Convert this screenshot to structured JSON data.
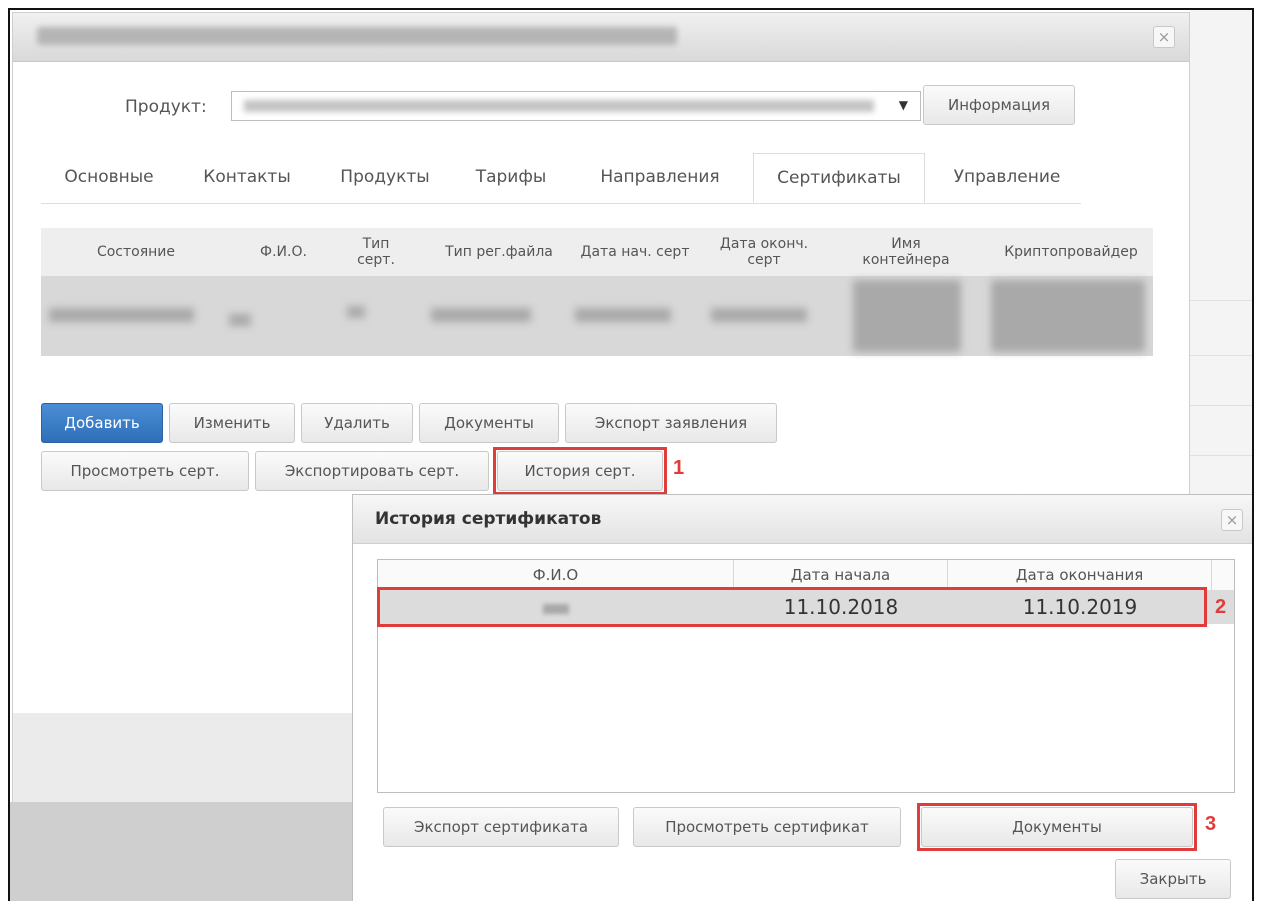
{
  "main_dialog": {
    "close_glyph": "×",
    "product_label": "Продукт:",
    "dropdown_arrow": "▼",
    "info_button": "Информация",
    "tabs": [
      "Основные",
      "Контакты",
      "Продукты",
      "Тарифы",
      "Направления",
      "Сертификаты",
      "Управление"
    ],
    "active_tab": "Сертификаты",
    "table": {
      "columns": [
        "Состояние",
        "Ф.И.О.",
        "Тип серт.",
        "Тип рег.файла",
        "Дата нач. серт",
        "Дата оконч. серт",
        "Имя контейнера",
        "Криптопровайдер"
      ]
    },
    "buttons_row1": {
      "add": "Добавить",
      "edit": "Изменить",
      "delete": "Удалить",
      "documents": "Документы",
      "export_request": "Экспорт заявления"
    },
    "buttons_row2": {
      "view_cert": "Просмотреть серт.",
      "export_cert": "Экспортировать серт.",
      "cert_history": "История серт."
    }
  },
  "history_dialog": {
    "title": "История сертификатов",
    "close_glyph": "×",
    "columns": [
      "Ф.И.О",
      "Дата начала",
      "Дата окончания"
    ],
    "rows": [
      {
        "fio": "",
        "start": "11.10.2018",
        "end": "11.10.2019"
      }
    ],
    "buttons": {
      "export_cert": "Экспорт сертификата",
      "view_cert": "Просмотреть сертификат",
      "documents": "Документы",
      "close": "Закрыть"
    }
  },
  "annotations": {
    "marker_1": "1",
    "marker_2": "2",
    "marker_3": "3",
    "highlight_color": "#e03c3c"
  }
}
